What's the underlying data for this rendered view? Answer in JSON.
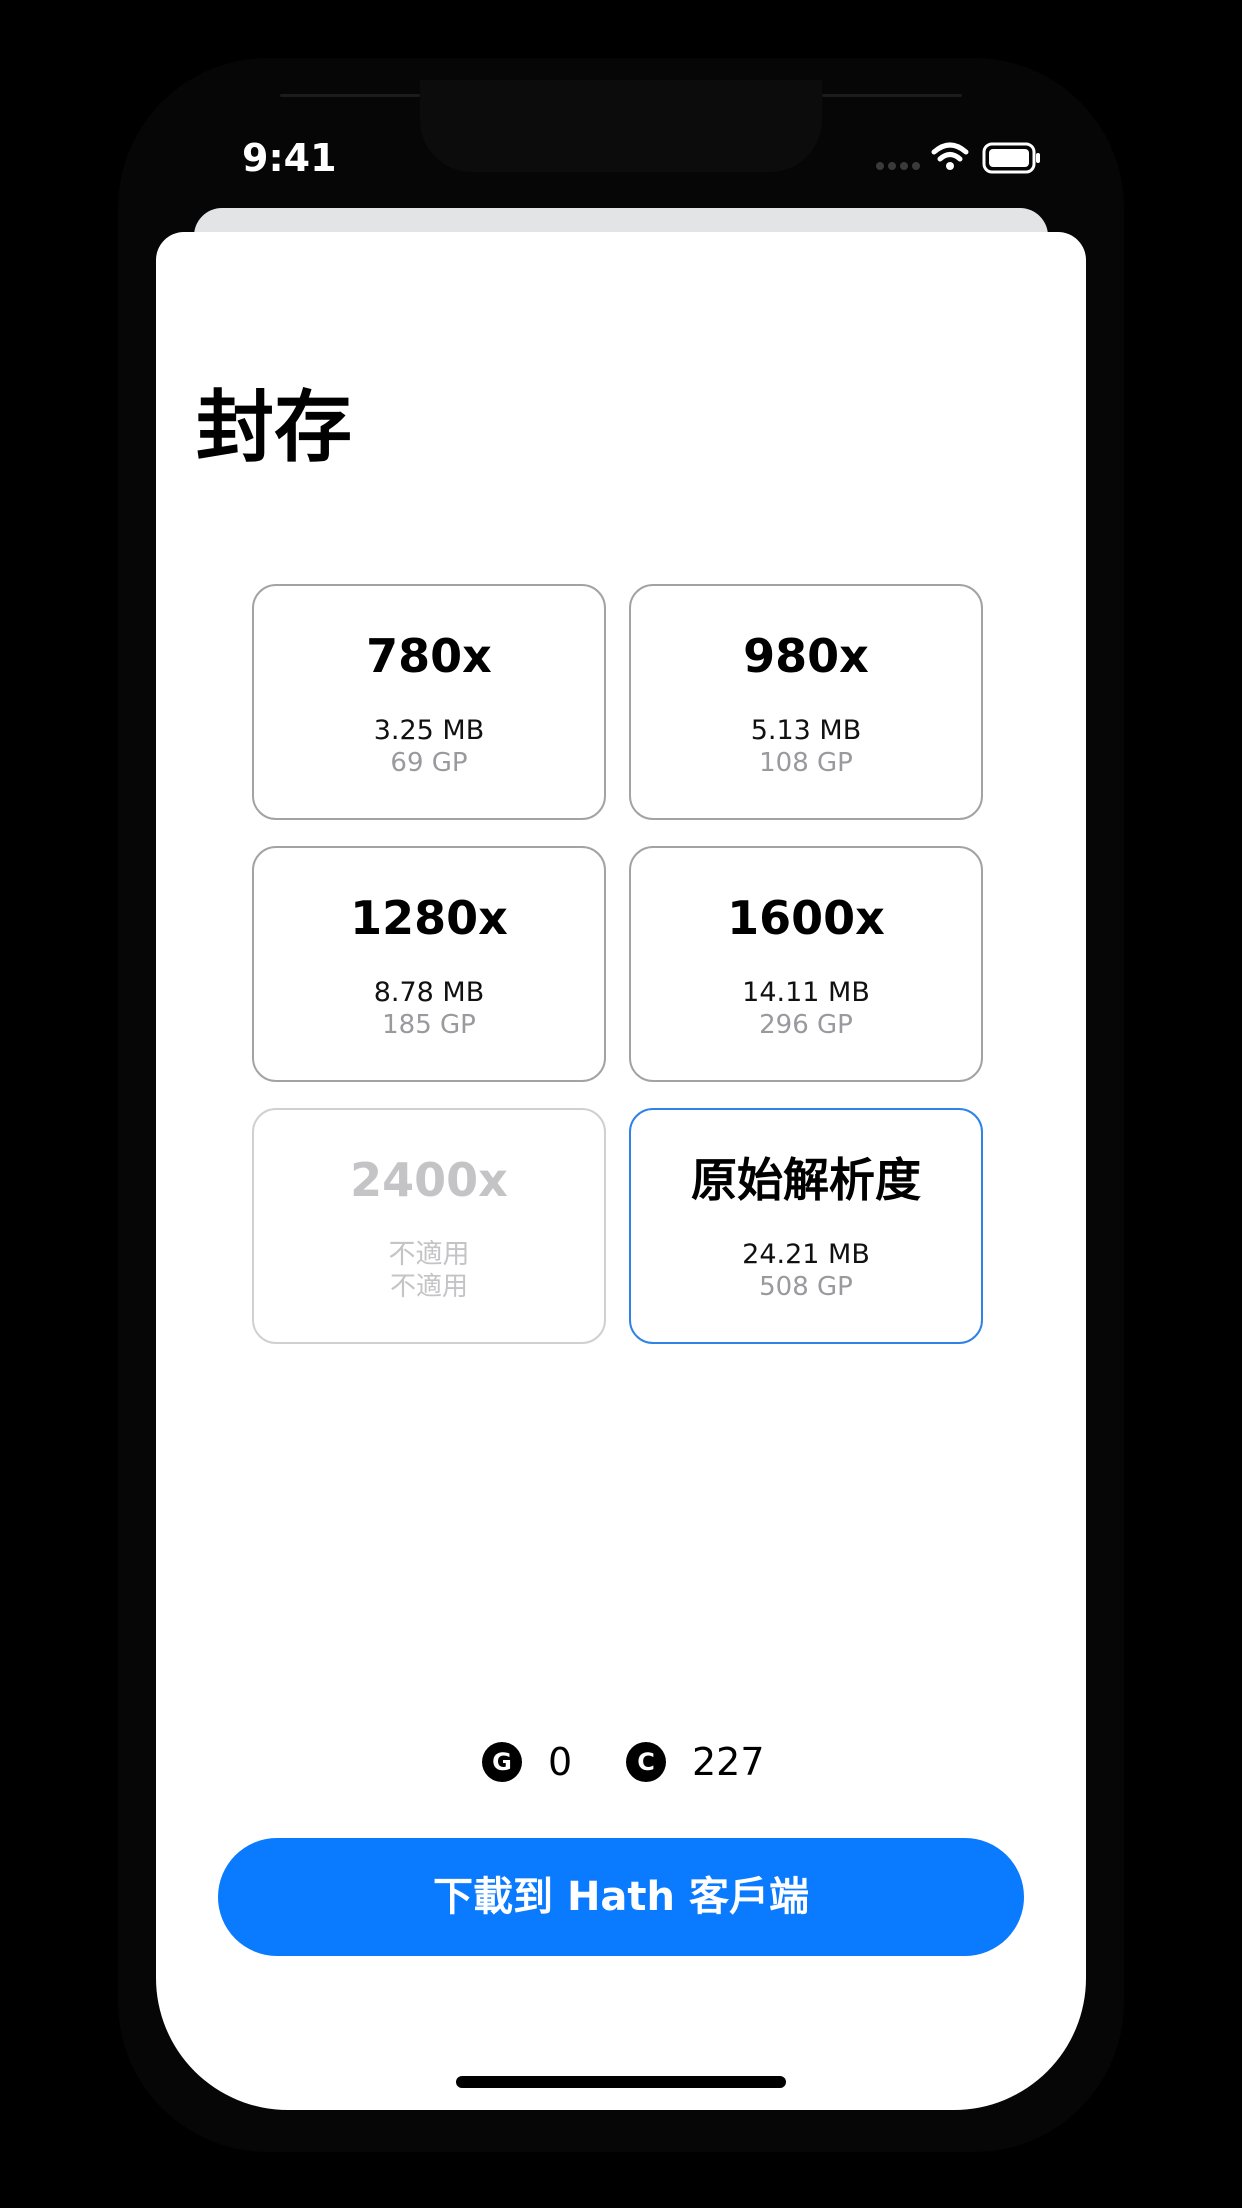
{
  "status_bar": {
    "time": "9:41"
  },
  "sheet": {
    "title": "封存"
  },
  "options": [
    {
      "resolution": "780x",
      "size": "3.25 MB",
      "cost": "69 GP",
      "state": "available"
    },
    {
      "resolution": "980x",
      "size": "5.13 MB",
      "cost": "108 GP",
      "state": "available"
    },
    {
      "resolution": "1280x",
      "size": "8.78 MB",
      "cost": "185 GP",
      "state": "available"
    },
    {
      "resolution": "1600x",
      "size": "14.11 MB",
      "cost": "296 GP",
      "state": "available"
    },
    {
      "resolution": "2400x",
      "size": "不適用",
      "cost": "不適用",
      "state": "disabled"
    },
    {
      "resolution": "原始解析度",
      "size": "24.21 MB",
      "cost": "508 GP",
      "state": "selected"
    }
  ],
  "balance": {
    "gp_symbol": "G",
    "gp_value": "0",
    "credits_symbol": "C",
    "credits_value": "227"
  },
  "download_button": {
    "label": "下載到 Hath 客戶端"
  },
  "colors": {
    "accent": "#0a7aff",
    "selected_border": "#2f82e6",
    "border": "#a3a3a5",
    "disabled": "#c4c4c6"
  }
}
